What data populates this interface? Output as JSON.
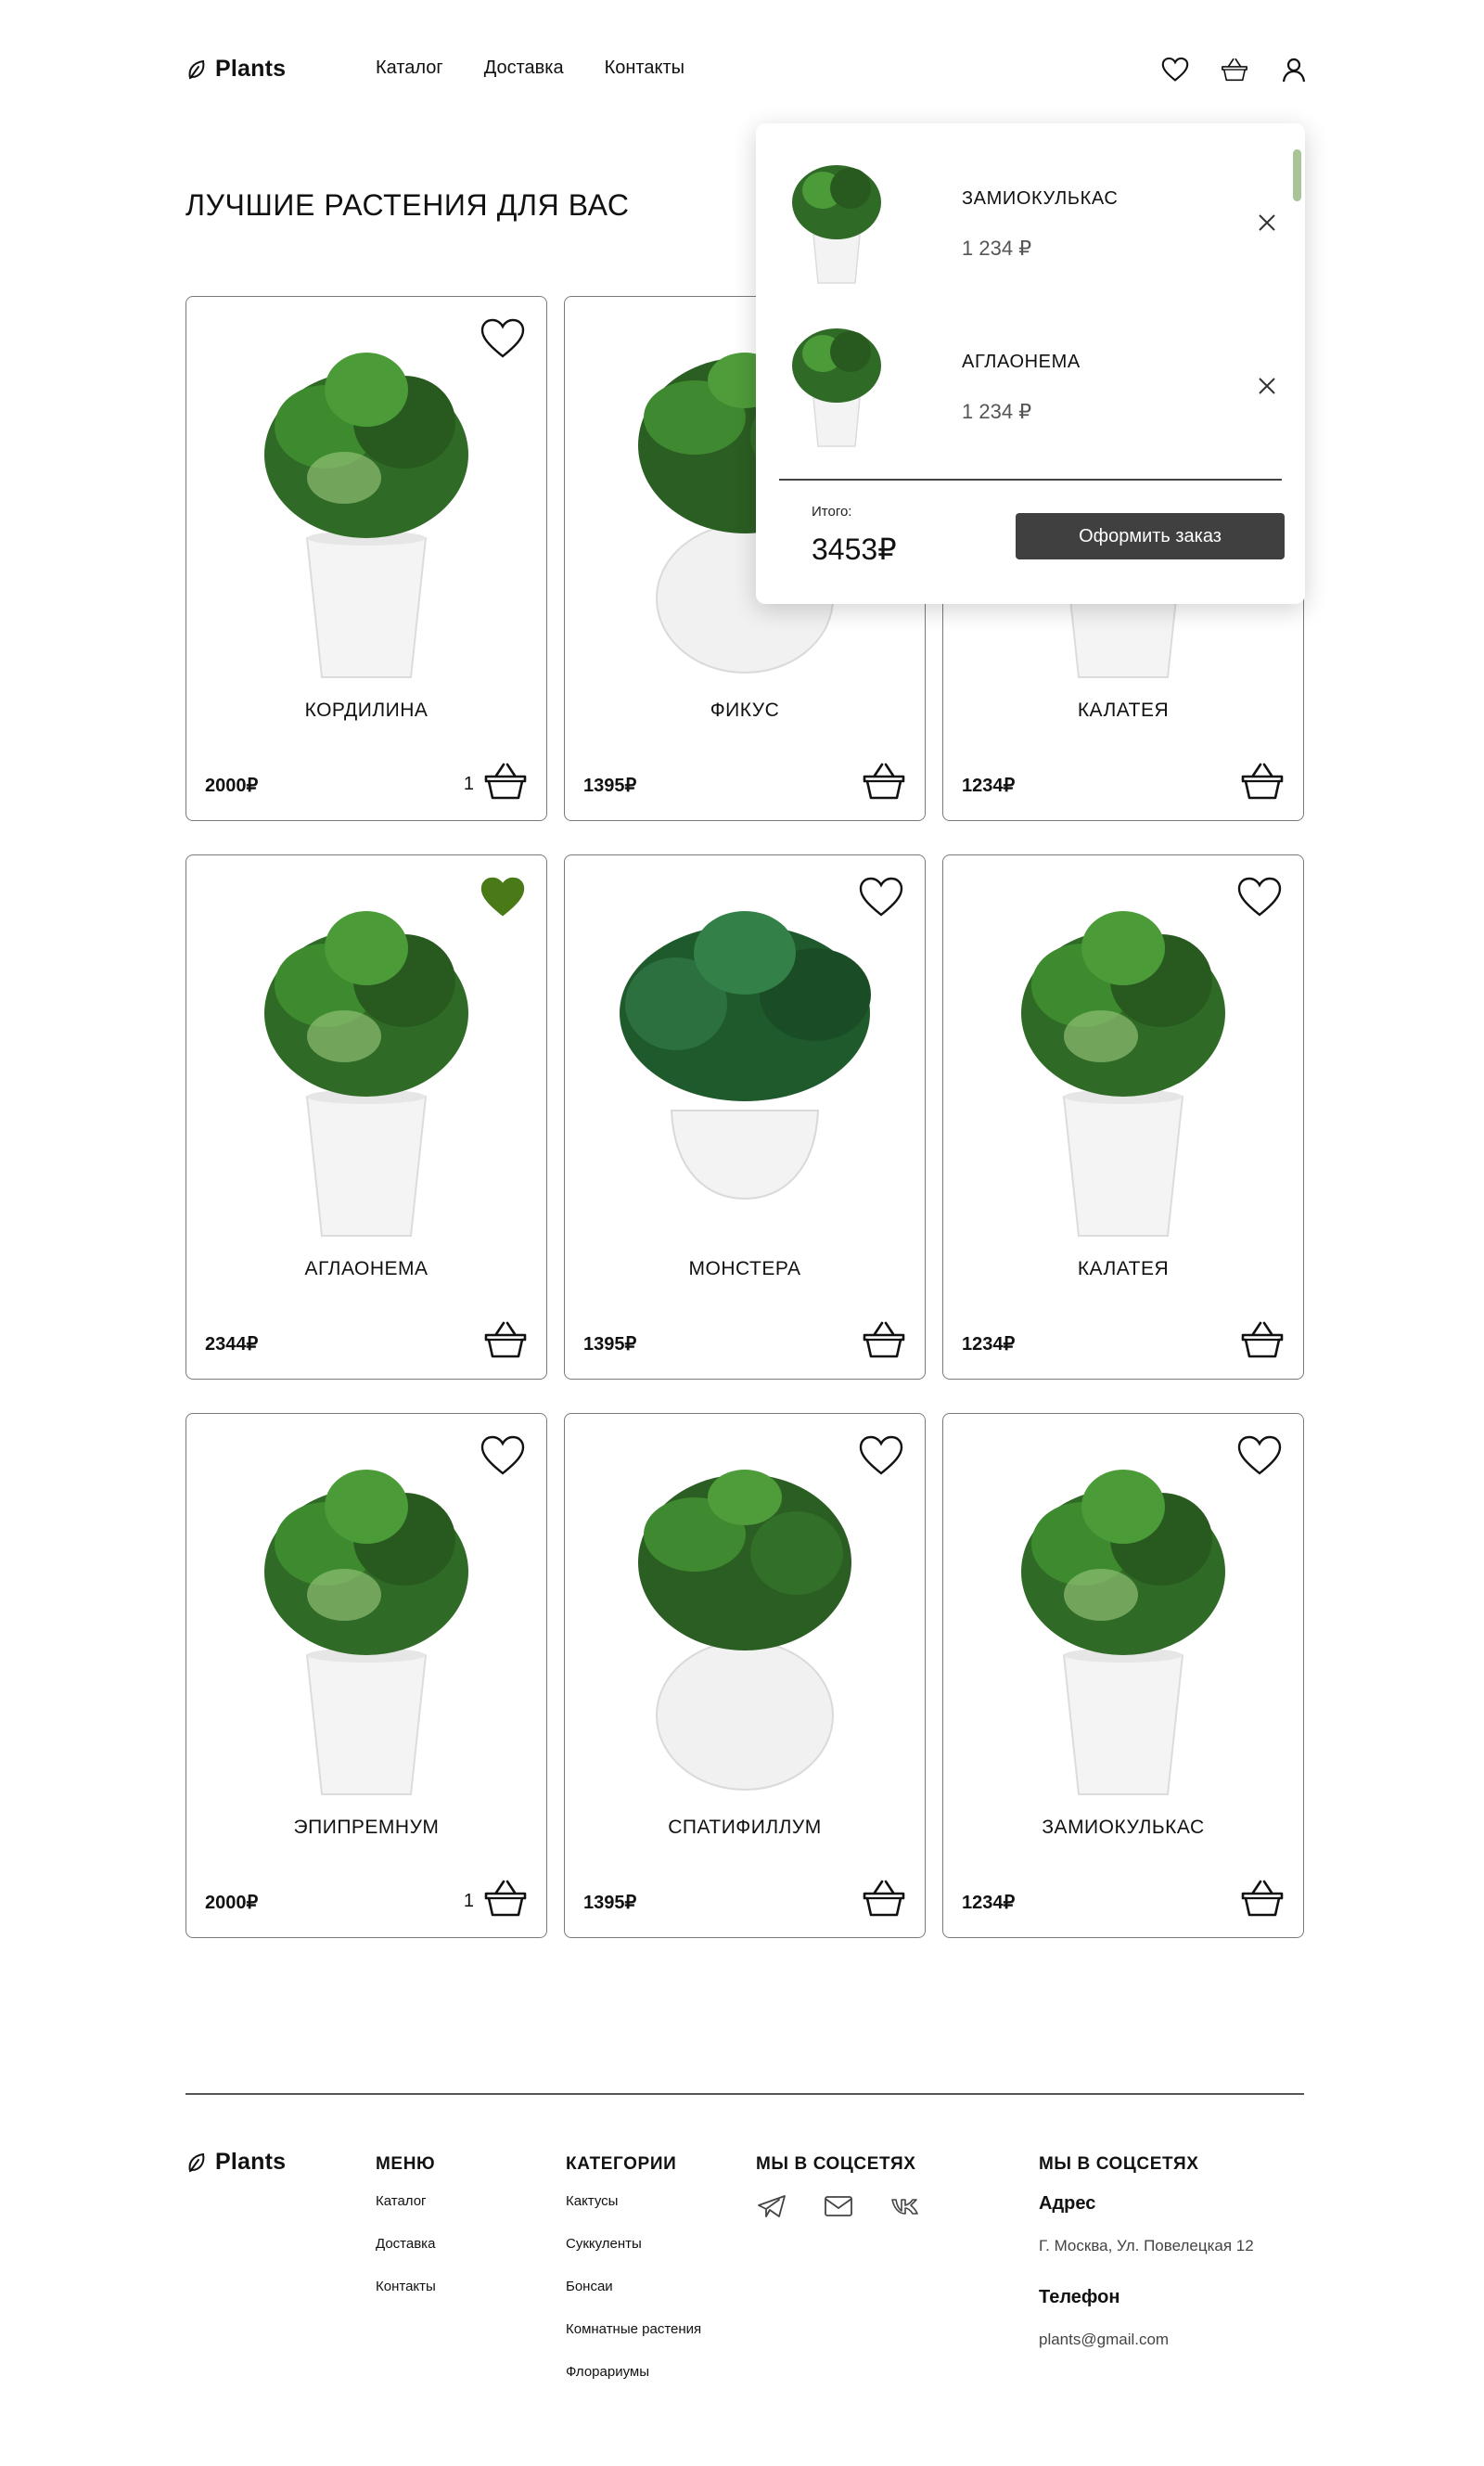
{
  "header": {
    "logo": "Plants",
    "nav": [
      "Каталог",
      "Доставка",
      "Контакты"
    ]
  },
  "title": "ЛУЧШИЕ РАСТЕНИЯ ДЛЯ ВАС",
  "products": [
    {
      "name": "КОРДИЛИНА",
      "price": "2000₽",
      "qty": "1",
      "favorite": false
    },
    {
      "name": "ФИКУС",
      "price": "1395₽",
      "qty": "",
      "favorite": false
    },
    {
      "name": "КАЛАТЕЯ",
      "price": "1234₽",
      "qty": "",
      "favorite": false
    },
    {
      "name": "АГЛАОНЕМА",
      "price": "2344₽",
      "qty": "",
      "favorite": true
    },
    {
      "name": "МОНСТЕРА",
      "price": "1395₽",
      "qty": "",
      "favorite": false
    },
    {
      "name": "КАЛАТЕЯ",
      "price": "1234₽",
      "qty": "",
      "favorite": false
    },
    {
      "name": "ЭПИПРЕМНУМ",
      "price": "2000₽",
      "qty": "1",
      "favorite": false
    },
    {
      "name": "СПАТИФИЛЛУМ",
      "price": "1395₽",
      "qty": "",
      "favorite": false
    },
    {
      "name": "ЗАМИОКУЛЬКАС",
      "price": "1234₽",
      "qty": "",
      "favorite": false
    }
  ],
  "cart": {
    "items": [
      {
        "name": "ЗАМИОКУЛЬКАС",
        "price": "1 234 ₽"
      },
      {
        "name": "АГЛАОНЕМА",
        "price": "1 234 ₽"
      }
    ],
    "total_label": "Итого:",
    "total": "3453₽",
    "order_button": "Оформить заказ"
  },
  "footer": {
    "logo": "Plants",
    "menu": {
      "title": "МЕНЮ",
      "items": [
        "Каталог",
        "Доставка",
        "Контакты"
      ]
    },
    "categories": {
      "title": "КАТЕГОРИИ",
      "items": [
        "Кактусы",
        "Суккуленты",
        "Бонсаи",
        "Комнатные растения",
        "Флорариумы"
      ]
    },
    "social": {
      "title": "МЫ В СОЦСЕТЯХ",
      "icons": [
        "telegram-icon",
        "mail-icon",
        "vk-icon"
      ]
    },
    "contacts": {
      "title": "МЫ В СОЦСЕТЯХ",
      "address_label": "Адрес",
      "address": "Г. Москва, Ул. Повелецкая 12",
      "phone_label": "Телефон",
      "email": "plants@gmail.com"
    }
  },
  "colors": {
    "accent_green": "#4a7a18",
    "button_dark": "#3f403f",
    "scrollbar": "#a9c497"
  }
}
